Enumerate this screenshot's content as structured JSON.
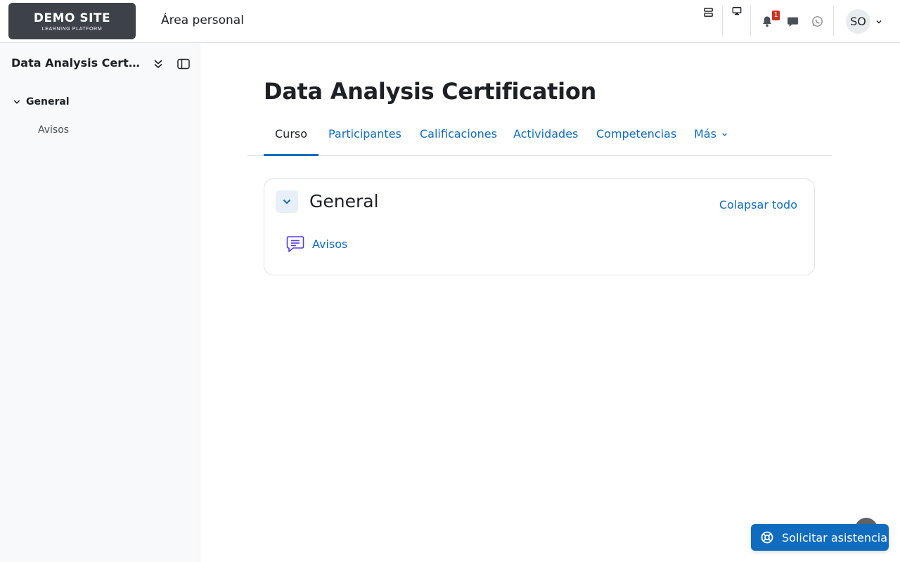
{
  "navbar": {
    "logo_title": "DEMO SITE",
    "logo_subtitle": "LEARNING PLATFORM",
    "home_link": "Área personal",
    "notification_count": "1",
    "user_initials": "SO"
  },
  "drawer": {
    "course_title": "Data Analysis Certification",
    "section_label": "General",
    "items": [
      {
        "label": "Avisos"
      }
    ]
  },
  "main": {
    "course_title": "Data Analysis Certification",
    "tabs": [
      {
        "label": "Curso",
        "active": true
      },
      {
        "label": "Participantes"
      },
      {
        "label": "Calificaciones"
      },
      {
        "label": "Actividades"
      },
      {
        "label": "Competencias"
      },
      {
        "label": "Más"
      }
    ],
    "section": {
      "title": "General",
      "collapse_all": "Colapsar todo",
      "activities": [
        {
          "name": "Avisos",
          "icon": "forum-icon"
        }
      ]
    }
  },
  "help": {
    "label": "Solicitar asistencia"
  },
  "colors": {
    "primary": "#0f6cbf",
    "badge": "#ca3120",
    "drawer_bg": "#f8f9fa",
    "activity_icon": "#5b3fd6"
  }
}
